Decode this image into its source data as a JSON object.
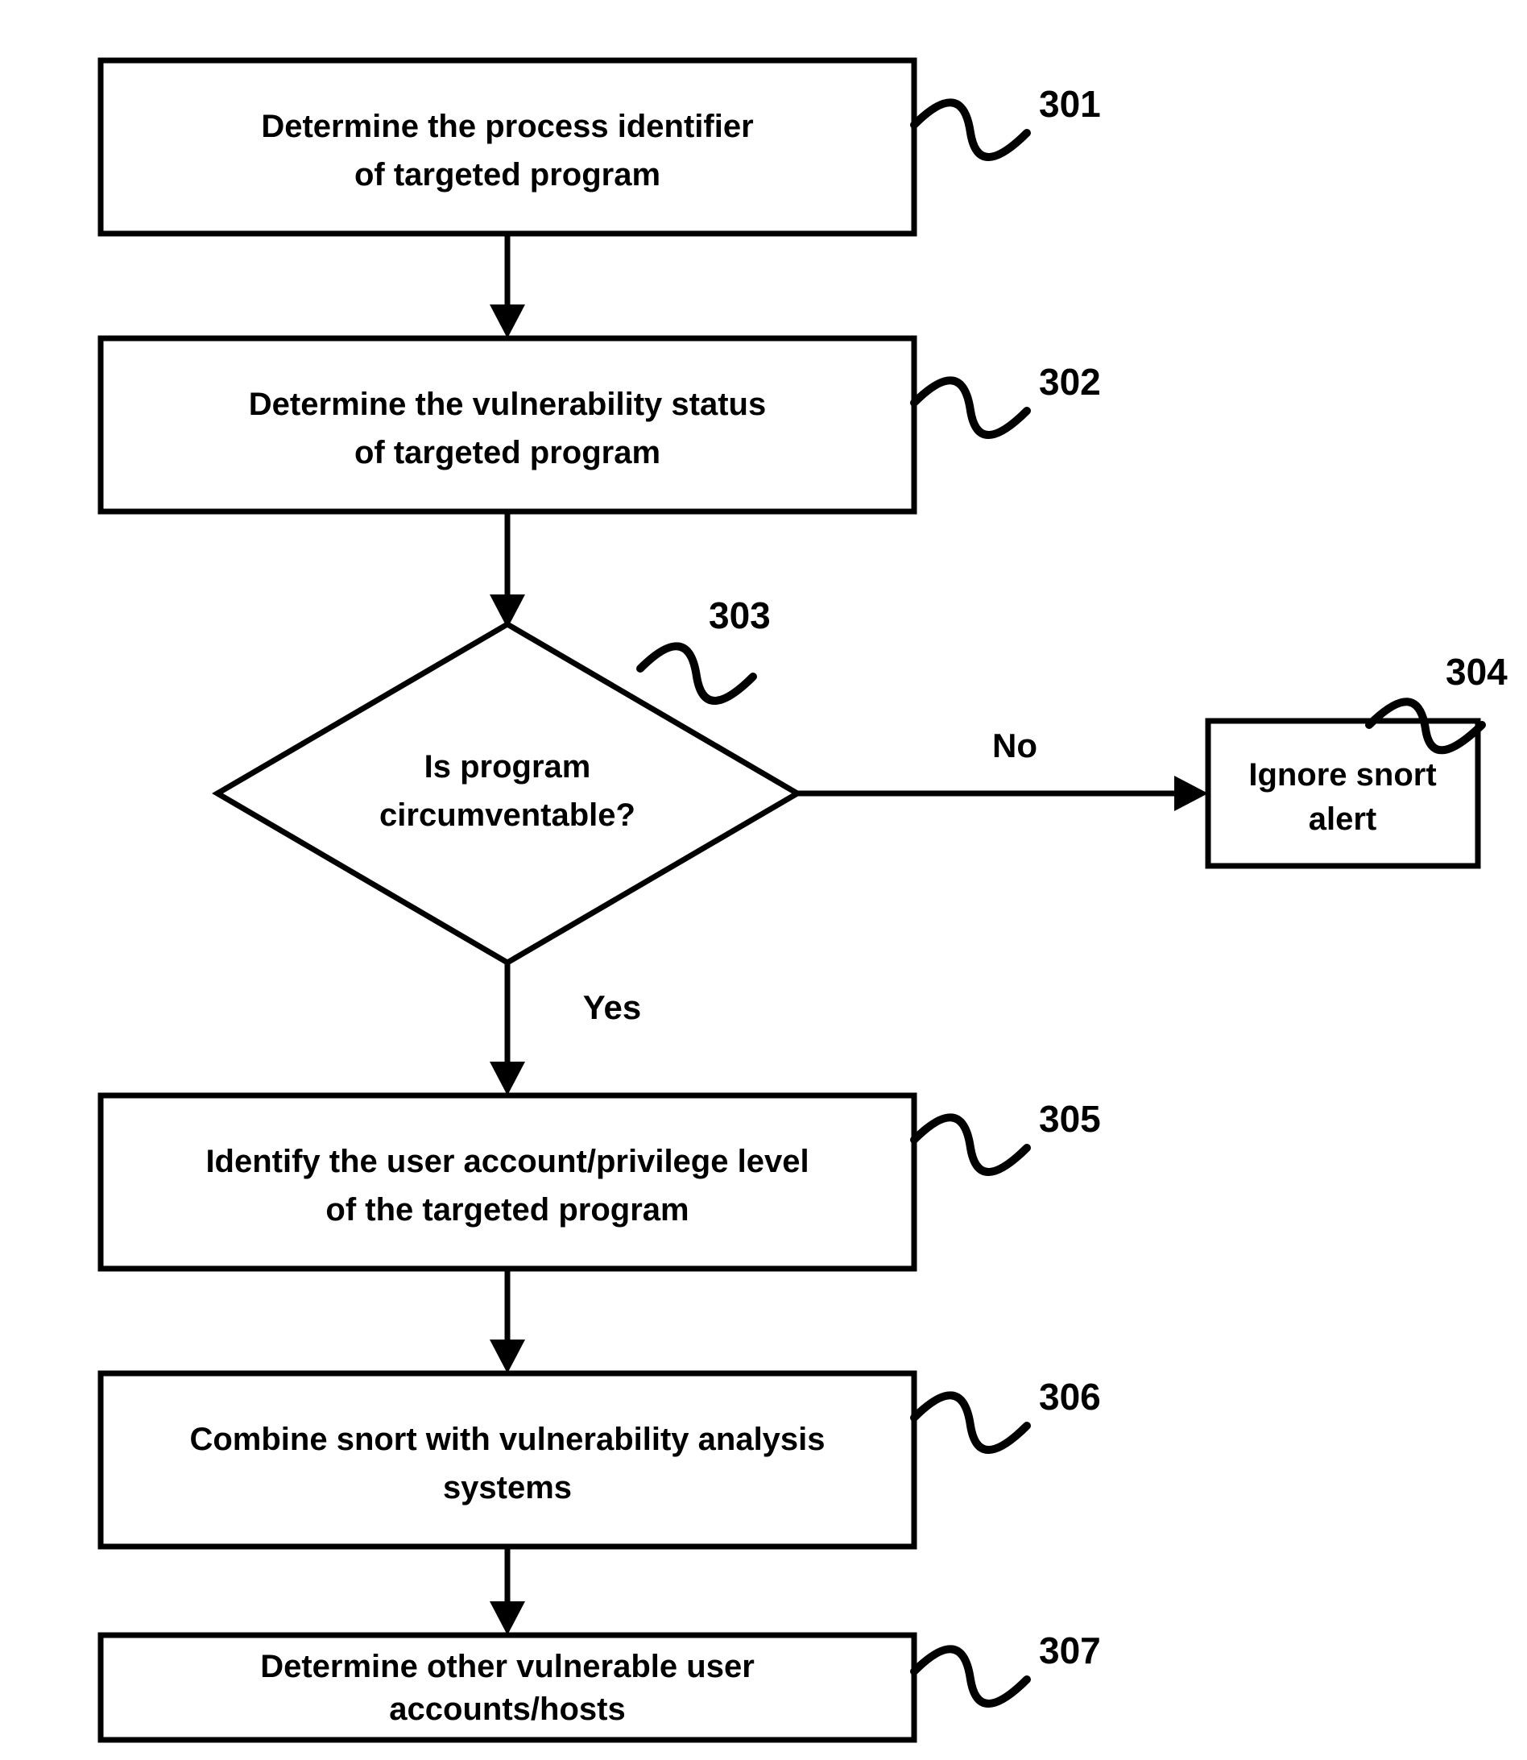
{
  "chart_data": {
    "type": "flowchart",
    "nodes": [
      {
        "id": "301",
        "kind": "process",
        "line1": "Determine the process identifier",
        "line2": "of targeted program"
      },
      {
        "id": "302",
        "kind": "process",
        "line1": "Determine the vulnerability status",
        "line2": "of targeted program"
      },
      {
        "id": "303",
        "kind": "decision",
        "line1": "Is program",
        "line2": "circumventable?"
      },
      {
        "id": "304",
        "kind": "process",
        "line1": "Ignore snort",
        "line2": "alert"
      },
      {
        "id": "305",
        "kind": "process",
        "line1": "Identify the user account/privilege level",
        "line2": "of the targeted program"
      },
      {
        "id": "306",
        "kind": "process",
        "line1": "Combine snort with vulnerability analysis",
        "line2": "systems"
      },
      {
        "id": "307",
        "kind": "process",
        "line1": "Determine other vulnerable user",
        "line2": "accounts/hosts"
      }
    ],
    "edges": [
      {
        "from": "301",
        "to": "302",
        "label": ""
      },
      {
        "from": "302",
        "to": "303",
        "label": ""
      },
      {
        "from": "303",
        "to": "304",
        "label": "No"
      },
      {
        "from": "303",
        "to": "305",
        "label": "Yes"
      },
      {
        "from": "305",
        "to": "306",
        "label": ""
      },
      {
        "from": "306",
        "to": "307",
        "label": ""
      }
    ]
  },
  "labels": {
    "n301": "301",
    "n302": "302",
    "n303": "303",
    "n304": "304",
    "n305": "305",
    "n306": "306",
    "n307": "307",
    "no": "No",
    "yes": "Yes"
  }
}
